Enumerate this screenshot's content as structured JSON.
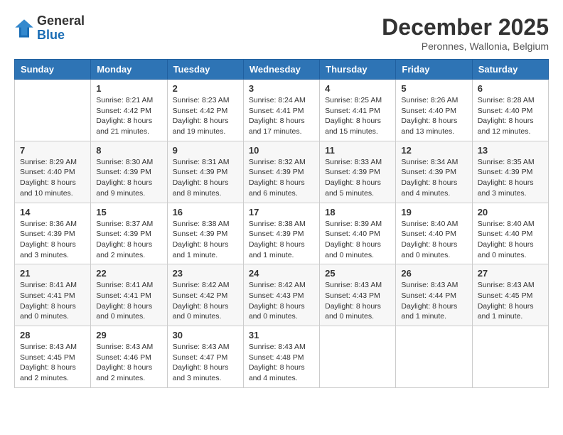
{
  "header": {
    "logo": {
      "general": "General",
      "blue": "Blue"
    },
    "title": "December 2025",
    "subtitle": "Peronnes, Wallonia, Belgium"
  },
  "calendar": {
    "days_of_week": [
      "Sunday",
      "Monday",
      "Tuesday",
      "Wednesday",
      "Thursday",
      "Friday",
      "Saturday"
    ],
    "weeks": [
      [
        {
          "day": "",
          "info": ""
        },
        {
          "day": "1",
          "info": "Sunrise: 8:21 AM\nSunset: 4:42 PM\nDaylight: 8 hours\nand 21 minutes."
        },
        {
          "day": "2",
          "info": "Sunrise: 8:23 AM\nSunset: 4:42 PM\nDaylight: 8 hours\nand 19 minutes."
        },
        {
          "day": "3",
          "info": "Sunrise: 8:24 AM\nSunset: 4:41 PM\nDaylight: 8 hours\nand 17 minutes."
        },
        {
          "day": "4",
          "info": "Sunrise: 8:25 AM\nSunset: 4:41 PM\nDaylight: 8 hours\nand 15 minutes."
        },
        {
          "day": "5",
          "info": "Sunrise: 8:26 AM\nSunset: 4:40 PM\nDaylight: 8 hours\nand 13 minutes."
        },
        {
          "day": "6",
          "info": "Sunrise: 8:28 AM\nSunset: 4:40 PM\nDaylight: 8 hours\nand 12 minutes."
        }
      ],
      [
        {
          "day": "7",
          "info": "Sunrise: 8:29 AM\nSunset: 4:40 PM\nDaylight: 8 hours\nand 10 minutes."
        },
        {
          "day": "8",
          "info": "Sunrise: 8:30 AM\nSunset: 4:39 PM\nDaylight: 8 hours\nand 9 minutes."
        },
        {
          "day": "9",
          "info": "Sunrise: 8:31 AM\nSunset: 4:39 PM\nDaylight: 8 hours\nand 8 minutes."
        },
        {
          "day": "10",
          "info": "Sunrise: 8:32 AM\nSunset: 4:39 PM\nDaylight: 8 hours\nand 6 minutes."
        },
        {
          "day": "11",
          "info": "Sunrise: 8:33 AM\nSunset: 4:39 PM\nDaylight: 8 hours\nand 5 minutes."
        },
        {
          "day": "12",
          "info": "Sunrise: 8:34 AM\nSunset: 4:39 PM\nDaylight: 8 hours\nand 4 minutes."
        },
        {
          "day": "13",
          "info": "Sunrise: 8:35 AM\nSunset: 4:39 PM\nDaylight: 8 hours\nand 3 minutes."
        }
      ],
      [
        {
          "day": "14",
          "info": "Sunrise: 8:36 AM\nSunset: 4:39 PM\nDaylight: 8 hours\nand 3 minutes."
        },
        {
          "day": "15",
          "info": "Sunrise: 8:37 AM\nSunset: 4:39 PM\nDaylight: 8 hours\nand 2 minutes."
        },
        {
          "day": "16",
          "info": "Sunrise: 8:38 AM\nSunset: 4:39 PM\nDaylight: 8 hours\nand 1 minute."
        },
        {
          "day": "17",
          "info": "Sunrise: 8:38 AM\nSunset: 4:39 PM\nDaylight: 8 hours\nand 1 minute."
        },
        {
          "day": "18",
          "info": "Sunrise: 8:39 AM\nSunset: 4:40 PM\nDaylight: 8 hours\nand 0 minutes."
        },
        {
          "day": "19",
          "info": "Sunrise: 8:40 AM\nSunset: 4:40 PM\nDaylight: 8 hours\nand 0 minutes."
        },
        {
          "day": "20",
          "info": "Sunrise: 8:40 AM\nSunset: 4:40 PM\nDaylight: 8 hours\nand 0 minutes."
        }
      ],
      [
        {
          "day": "21",
          "info": "Sunrise: 8:41 AM\nSunset: 4:41 PM\nDaylight: 8 hours\nand 0 minutes."
        },
        {
          "day": "22",
          "info": "Sunrise: 8:41 AM\nSunset: 4:41 PM\nDaylight: 8 hours\nand 0 minutes."
        },
        {
          "day": "23",
          "info": "Sunrise: 8:42 AM\nSunset: 4:42 PM\nDaylight: 8 hours\nand 0 minutes."
        },
        {
          "day": "24",
          "info": "Sunrise: 8:42 AM\nSunset: 4:43 PM\nDaylight: 8 hours\nand 0 minutes."
        },
        {
          "day": "25",
          "info": "Sunrise: 8:43 AM\nSunset: 4:43 PM\nDaylight: 8 hours\nand 0 minutes."
        },
        {
          "day": "26",
          "info": "Sunrise: 8:43 AM\nSunset: 4:44 PM\nDaylight: 8 hours\nand 1 minute."
        },
        {
          "day": "27",
          "info": "Sunrise: 8:43 AM\nSunset: 4:45 PM\nDaylight: 8 hours\nand 1 minute."
        }
      ],
      [
        {
          "day": "28",
          "info": "Sunrise: 8:43 AM\nSunset: 4:45 PM\nDaylight: 8 hours\nand 2 minutes."
        },
        {
          "day": "29",
          "info": "Sunrise: 8:43 AM\nSunset: 4:46 PM\nDaylight: 8 hours\nand 2 minutes."
        },
        {
          "day": "30",
          "info": "Sunrise: 8:43 AM\nSunset: 4:47 PM\nDaylight: 8 hours\nand 3 minutes."
        },
        {
          "day": "31",
          "info": "Sunrise: 8:43 AM\nSunset: 4:48 PM\nDaylight: 8 hours\nand 4 minutes."
        },
        {
          "day": "",
          "info": ""
        },
        {
          "day": "",
          "info": ""
        },
        {
          "day": "",
          "info": ""
        }
      ]
    ]
  }
}
